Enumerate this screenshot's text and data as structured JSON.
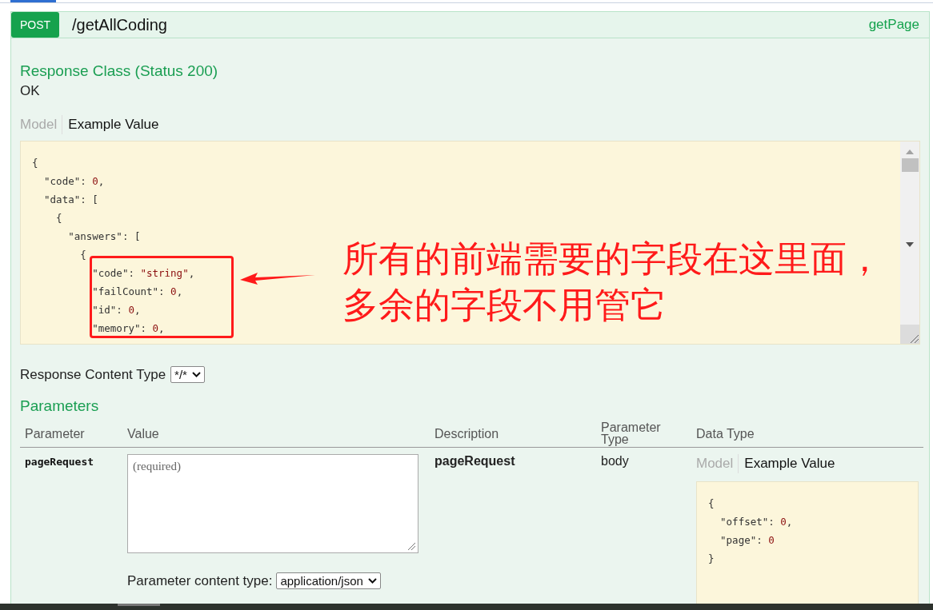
{
  "operation": {
    "method": "POST",
    "path": "/getAllCoding",
    "nickname": "getPage"
  },
  "response_class": {
    "title": "Response Class (Status 200)",
    "status": "OK",
    "tabs": [
      {
        "label": "Model",
        "selected": false
      },
      {
        "label": "Example Value",
        "selected": true
      }
    ],
    "example_lines": [
      {
        "key": "{"
      },
      {
        "key": "  \"code\": ",
        "value": "0",
        "tail": ","
      },
      {
        "key": "  \"data\": ["
      },
      {
        "key": "    {"
      },
      {
        "key": "      \"answers\": ["
      },
      {
        "key": "        {"
      },
      {
        "key": "          \"code\": ",
        "value": "\"string\"",
        "tail": ","
      },
      {
        "key": "          \"failCount\": ",
        "value": "0",
        "tail": ","
      },
      {
        "key": "          \"id\": ",
        "value": "0",
        "tail": ","
      },
      {
        "key": "          \"memory\": ",
        "value": "0",
        "tail": ","
      }
    ]
  },
  "annotation": {
    "lines": [
      "所有的前端需要的字段在这里面，",
      "多余的字段不用管它"
    ]
  },
  "response_content_type": {
    "label": "Response Content Type",
    "value": "*/*"
  },
  "parameters": {
    "title": "Parameters",
    "columns": [
      "Parameter",
      "Value",
      "Description",
      "Parameter Type",
      "Data Type"
    ],
    "rows": [
      {
        "name": "pageRequest",
        "placeholder": "(required)",
        "description": "pageRequest",
        "type": "body",
        "tabs": [
          {
            "label": "Model",
            "selected": false
          },
          {
            "label": "Example Value",
            "selected": true
          }
        ],
        "example_lines": [
          {
            "key": "{"
          },
          {
            "key": "  \"offset\": ",
            "value": "0",
            "tail": ","
          },
          {
            "key": "  \"page\": ",
            "value": "0"
          },
          {
            "key": "}"
          }
        ],
        "content_type_label": "Parameter content type:",
        "content_type": "application/json"
      }
    ]
  }
}
